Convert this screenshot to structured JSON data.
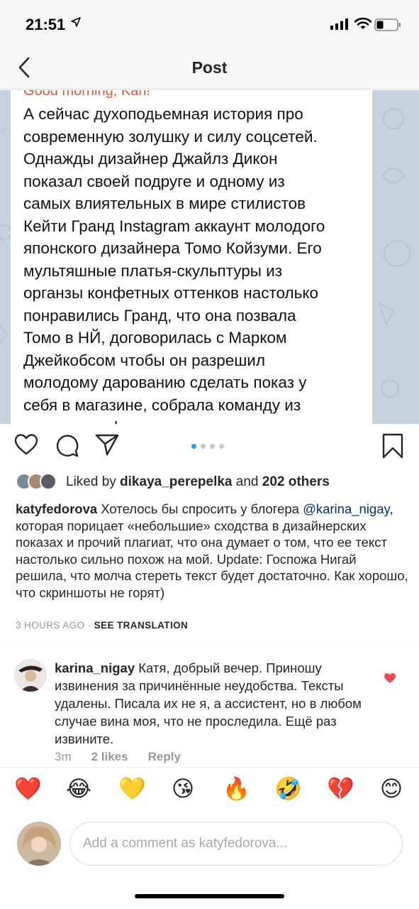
{
  "status_bar": {
    "time": "21:51",
    "location_icon": "location-arrow-icon",
    "signal_icon": "cellular-signal-icon",
    "wifi_icon": "wifi-icon",
    "battery_icon": "battery-icon"
  },
  "nav": {
    "back_icon": "chevron-left-icon",
    "title": "Post"
  },
  "post_image": {
    "greeting": "Good morning, Kari!",
    "lines": [
      "А сейчас духоподьемная история про",
      "современную золушку и силу соцсетей.",
      "Однажды дизайнер Джайлз Дикон",
      "показал своей подруге и одному из",
      "самых влиятельных в мире стилистов",
      "Кейти Гранд Instagram аккаунт молодого",
      "японского дизайнера Томо Койзуми. Его",
      "мультяшные платья-скульптуры из",
      "органзы конфетных оттенков настолько",
      "понравились Гранд,  что она позвала",
      "Томо в НЙ, договорилась с Марком",
      "Джейкобсом чтобы он разрешил",
      "молодому дарованию сделать показ у",
      "себя в магазине, собрала команду из",
      "лучших профессионалов индустрии"
    ]
  },
  "actions": {
    "like_icon": "heart-outline-icon",
    "comment_icon": "comment-bubble-icon",
    "share_icon": "paper-plane-icon",
    "save_icon": "bookmark-icon",
    "carousel_total": 4,
    "carousel_active": 1
  },
  "likes": {
    "prefix": "Liked by ",
    "user": "dikaya_perepelka",
    "middle": " and ",
    "others": "202 others"
  },
  "caption": {
    "user": "katyfedorova",
    "text_before": " Хотелось бы спросить у блогера ",
    "mention": "@karina_nigay",
    "text_after": ", которая порицает «небольшие» сходства в дизайнерских показах и прочий плагиат, что она думает о том, что ее текст настолько сильно похож на мой.  Update: Госпожа Нигай решила, что молча стереть текст будет достаточно. Как хорошо, что скриншоты не горят)"
  },
  "meta": {
    "time": "3 HOURS AGO",
    "separator": " · ",
    "see_translation": "SEE TRANSLATION"
  },
  "comment": {
    "user": "karina_nigay",
    "text": " Катя, добрый вечер. Приношу извинения за причинённые неудобства. Тексты удалены. Писала их не я, а ассистент, но в любом случае вина моя, что не проследила. Ещё раз извините.",
    "time": "3m",
    "likes": "2 likes",
    "reply": "Reply",
    "heart_color": "#ed4956"
  },
  "emoji_bar": [
    "❤️",
    "😂",
    "💛",
    "😘",
    "🔥",
    "🤣",
    "💔",
    "😊"
  ],
  "comment_input": {
    "placeholder": "Add a comment as katyfedorova..."
  },
  "colors": {
    "accent_blue": "#3897f0",
    "mention": "#003569",
    "like_red": "#ed4956",
    "greeting_orange": "#d6593c"
  }
}
